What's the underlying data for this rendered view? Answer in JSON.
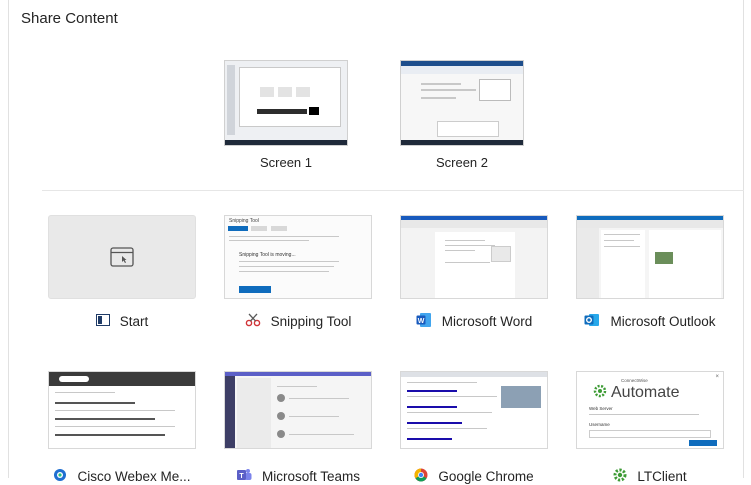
{
  "dialog": {
    "title": "Share Content"
  },
  "screens": [
    {
      "label": "Screen 1"
    },
    {
      "label": "Screen 2"
    }
  ],
  "apps": [
    {
      "label": "Start",
      "icon": "start-icon"
    },
    {
      "label": "Snipping Tool",
      "icon": "snipping-tool-icon"
    },
    {
      "label": "Microsoft Word",
      "icon": "word-icon"
    },
    {
      "label": "Microsoft Outlook",
      "icon": "outlook-icon"
    },
    {
      "label": "Cisco Webex Me...",
      "icon": "webex-icon"
    },
    {
      "label": "Microsoft Teams",
      "icon": "teams-icon"
    },
    {
      "label": "Google Chrome",
      "icon": "chrome-icon"
    },
    {
      "label": "LTClient",
      "icon": "ltclient-icon"
    }
  ],
  "previews": {
    "snipping_title": "Snipping Tool",
    "snipping_moving": "Snipping Tool is moving...",
    "automate_brand": "ConnectWise",
    "automate_name": "Automate",
    "automate_field1": "Web Server",
    "automate_field2": "Username"
  },
  "colors": {
    "word": "#185abd",
    "outlook": "#0f6cbd",
    "teams": "#5b5fc7",
    "webex": "#1f6fd1",
    "ltclient": "#3d9b35"
  }
}
